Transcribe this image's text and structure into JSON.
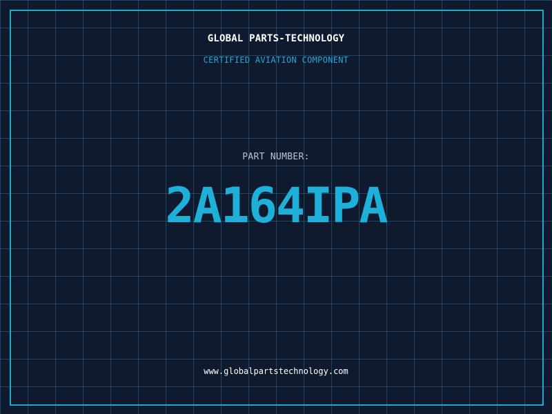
{
  "header": {
    "company": "GLOBAL PARTS-TECHNOLOGY",
    "subtitle": "CERTIFIED AVIATION COMPONENT"
  },
  "part": {
    "label": "PART NUMBER:",
    "number": "2A164IPA"
  },
  "footer": {
    "website": "www.globalpartstechnology.com"
  },
  "colors": {
    "background": "#0f1a2e",
    "grid": "#226e8a",
    "accent": "#1eb0d8",
    "frame": "#1fa9cf",
    "text": "#ffffff",
    "label": "#b9c3cf"
  }
}
